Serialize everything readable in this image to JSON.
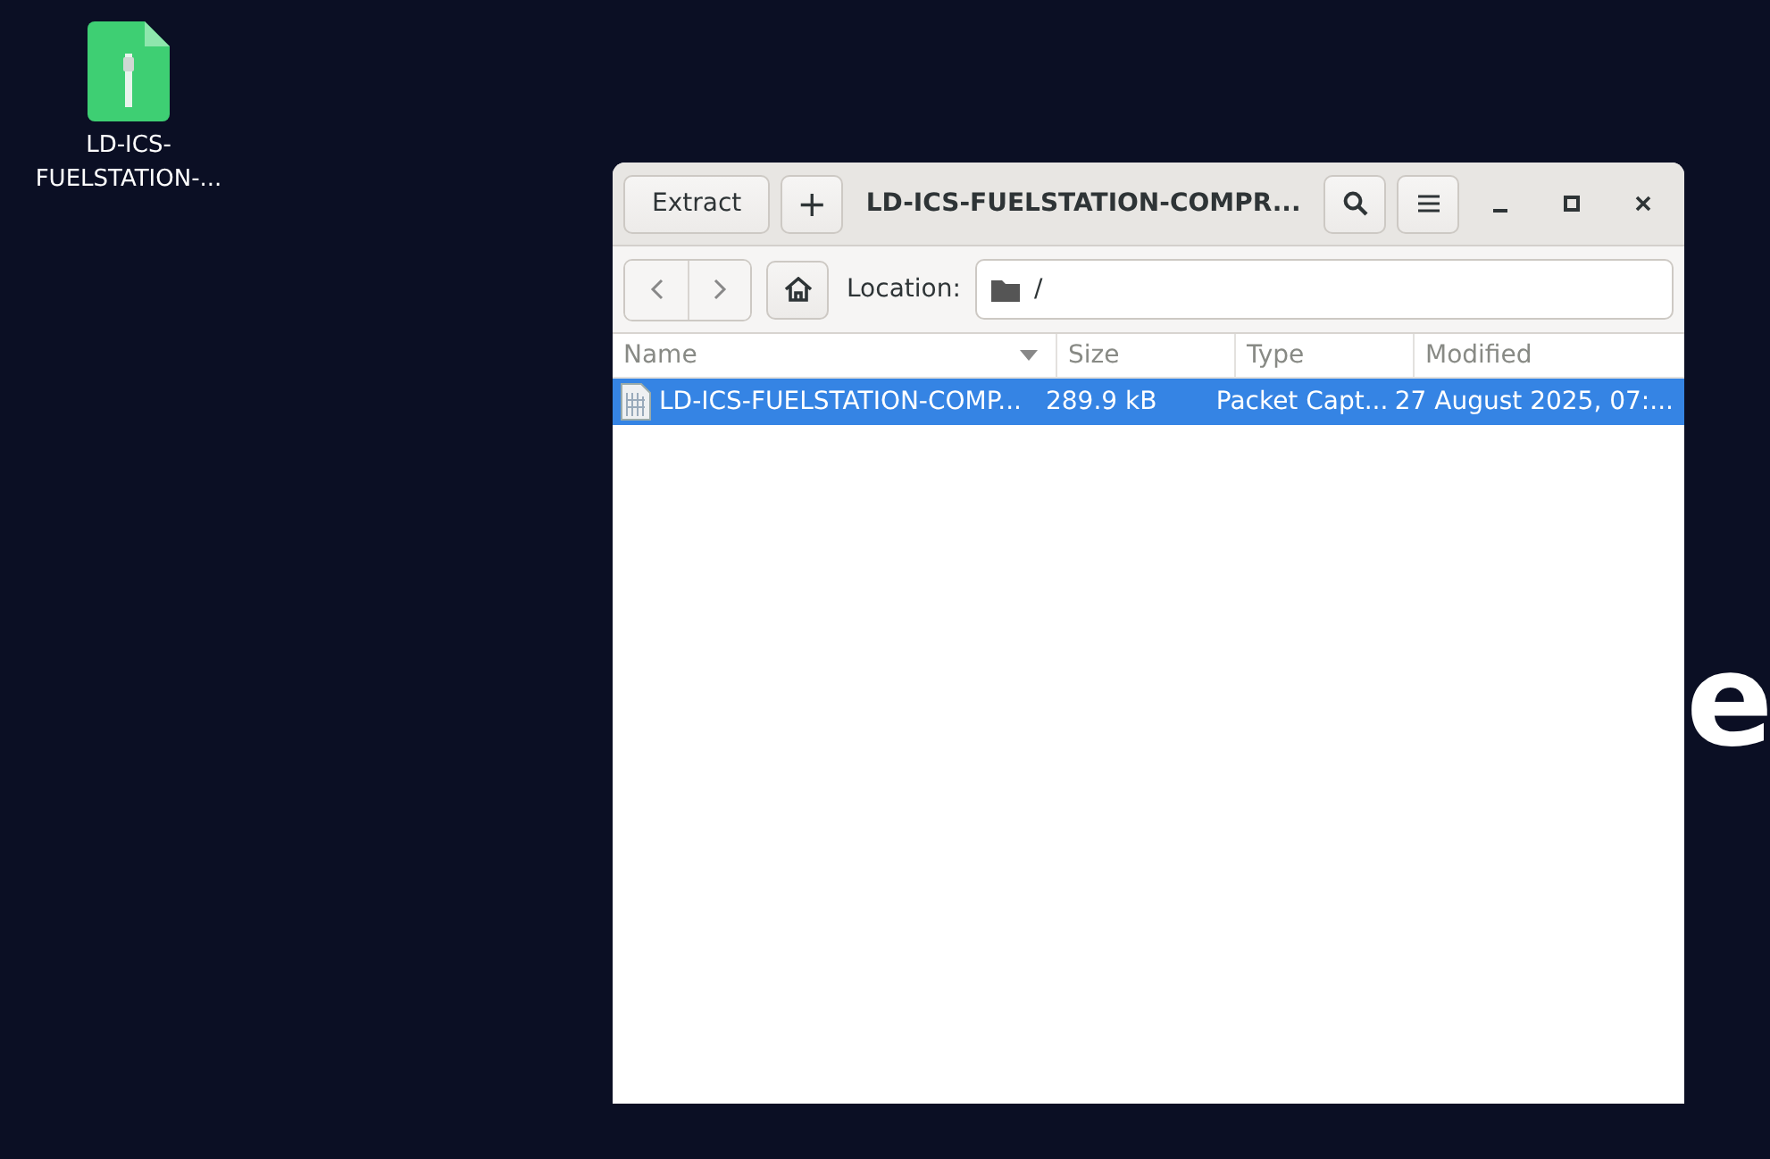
{
  "desktop": {
    "icon_label": "LD-ICS-\nFUELSTATION-...",
    "wallpaper_text": "e"
  },
  "window": {
    "title": "LD-ICS-FUELSTATION-COMPR...",
    "extract_button": "Extract",
    "add_button": "+"
  },
  "location": {
    "label": "Location:",
    "value": "/"
  },
  "table": {
    "columns": [
      {
        "label": "Name",
        "sorted": true
      },
      {
        "label": "Size",
        "sorted": false
      },
      {
        "label": "Type",
        "sorted": false
      },
      {
        "label": "Modified",
        "sorted": false
      }
    ],
    "rows": [
      {
        "name": "LD-ICS-FUELSTATION-COMP...",
        "size": "289.9 kB",
        "type": "Packet Capt...",
        "modified": "27 August 2025, 07:...",
        "selected": true
      }
    ]
  }
}
